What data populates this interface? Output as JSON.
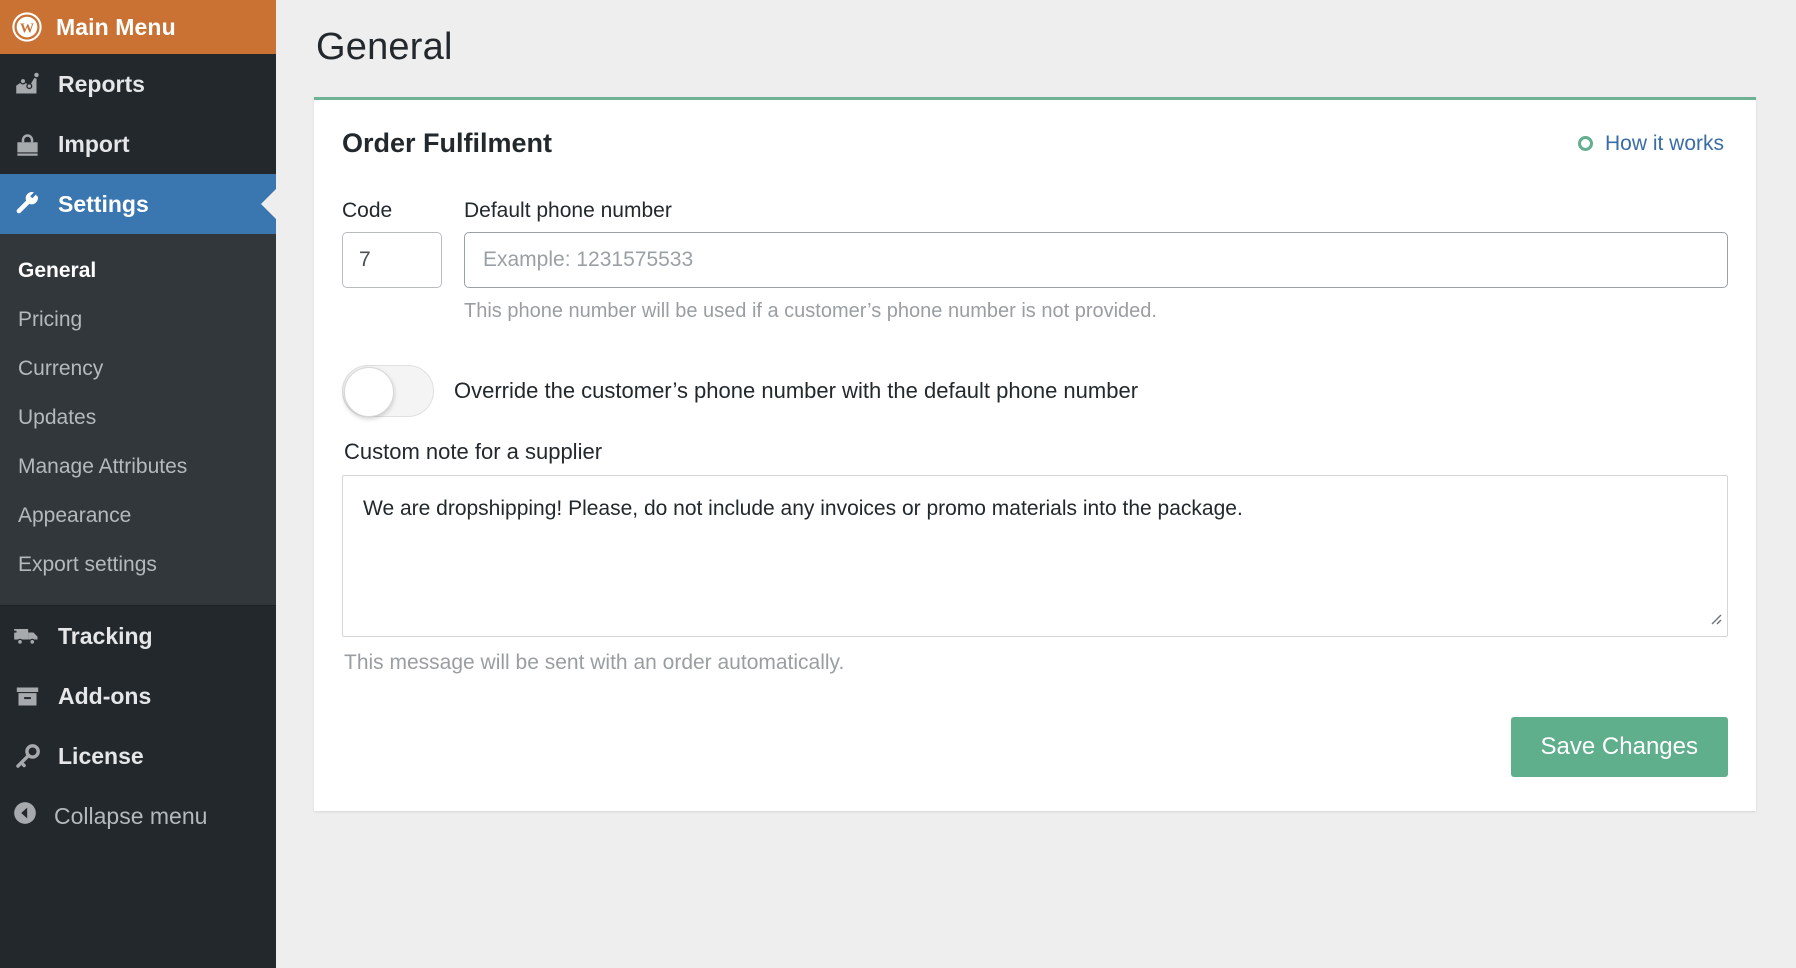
{
  "sidebar": {
    "header": {
      "label": "Main Menu",
      "icon": "wordpress-logo-icon",
      "bg_color": "#CA7234"
    },
    "items": [
      {
        "label": "Reports",
        "icon": "chart-icon"
      },
      {
        "label": "Import",
        "icon": "bag-icon"
      },
      {
        "label": "Settings",
        "icon": "wrench-icon",
        "active": true
      }
    ],
    "submenu": [
      {
        "label": "General",
        "current": true
      },
      {
        "label": "Pricing",
        "current": false
      },
      {
        "label": "Currency",
        "current": false
      },
      {
        "label": "Updates",
        "current": false
      },
      {
        "label": "Manage Attributes",
        "current": false
      },
      {
        "label": "Appearance",
        "current": false
      },
      {
        "label": "Export settings",
        "current": false
      }
    ],
    "bottom_items": [
      {
        "label": "Tracking",
        "icon": "truck-icon"
      },
      {
        "label": "Add-ons",
        "icon": "box-icon"
      },
      {
        "label": "License",
        "icon": "key-icon"
      }
    ],
    "collapse": {
      "label": "Collapse menu",
      "icon": "collapse-arrow-icon"
    },
    "active_color": "#3A76AF",
    "bg_color": "#23282D",
    "submenu_bg_color": "#32373C"
  },
  "main": {
    "page_title": "General",
    "card": {
      "title": "Order Fulfilment",
      "accent_color": "#6FB195",
      "how_it_works": {
        "label": "How it works",
        "icon": "circle-outline-icon",
        "color": "#3A6DA8"
      },
      "code_field": {
        "label": "Code",
        "value": "7"
      },
      "phone_field": {
        "label": "Default phone number",
        "value": "",
        "placeholder": "Example: 1231575533",
        "hint": "This phone number will be used if a customer’s phone number is not provided."
      },
      "override_toggle": {
        "label": "Override the customer’s phone number with the default phone number",
        "state": "off"
      },
      "note_field": {
        "label": "Custom note for a supplier",
        "value": "We are dropshipping! Please, do not include any invoices or promo materials into the package.",
        "hint": "This message will be sent with an order automatically."
      },
      "save_button": {
        "label": "Save Changes",
        "color": "#5FAE8C"
      }
    }
  }
}
